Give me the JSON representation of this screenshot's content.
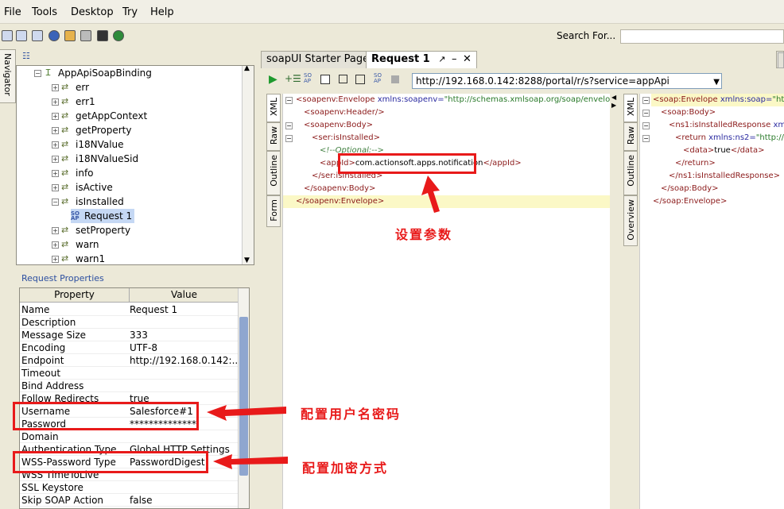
{
  "menu": [
    "File",
    "Tools",
    "Desktop",
    "Try",
    "Help"
  ],
  "search": {
    "label": "Search For..."
  },
  "navigator_label": "Navigator",
  "tree": {
    "binding": "AppApiSoapBinding",
    "operations": [
      "err",
      "err1",
      "getAppContext",
      "getProperty",
      "i18NValue",
      "i18NValueSid",
      "info",
      "isActive",
      "isInstalled"
    ],
    "selected_request": "Request 1",
    "operations_after": [
      "setProperty",
      "warn",
      "warn1"
    ]
  },
  "properties": {
    "title": "Request Properties",
    "col_property": "Property",
    "col_value": "Value",
    "rows": [
      {
        "k": "Name",
        "v": "Request 1"
      },
      {
        "k": "Description",
        "v": ""
      },
      {
        "k": "Message Size",
        "v": "333"
      },
      {
        "k": "Encoding",
        "v": "UTF-8"
      },
      {
        "k": "Endpoint",
        "v": "http://192.168.0.142:..."
      },
      {
        "k": "Timeout",
        "v": ""
      },
      {
        "k": "Bind Address",
        "v": ""
      },
      {
        "k": "Follow Redirects",
        "v": "true"
      },
      {
        "k": "Username",
        "v": "Salesforce#1"
      },
      {
        "k": "Password",
        "v": "**************"
      },
      {
        "k": "Domain",
        "v": ""
      },
      {
        "k": "Authentication Type",
        "v": "Global HTTP Settings"
      },
      {
        "k": "WSS-Password Type",
        "v": "PasswordDigest"
      },
      {
        "k": "WSS TimeToLive",
        "v": ""
      },
      {
        "k": "SSL Keystore",
        "v": ""
      },
      {
        "k": "Skip SOAP Action",
        "v": "false"
      }
    ]
  },
  "tabs": {
    "starter": "soapUI Starter Page",
    "request": "Request 1"
  },
  "endpoint": "http://192.168.0.142:8288/portal/r/s?service=appApi",
  "side_tabs_req": [
    "XML",
    "Raw",
    "Outline",
    "Form"
  ],
  "side_tabs_resp": [
    "XML",
    "Raw",
    "Outline",
    "Overview"
  ],
  "request_xml": {
    "l1_tag": "<soapenv:Envelope ",
    "l1_attr": "xmlns:soapenv=",
    "l1_str": "\"http://schemas.xmlsoap.org/soap/envelop",
    "l2": "<soapenv:Header/>",
    "l3": "<soapenv:Body>",
    "l4": "<ser:isInstalled>",
    "l5": "<!--Optional:-->",
    "l6_open": "<appId>",
    "l6_val": "com.actionsoft.apps.notification",
    "l6_close": "</appId>",
    "l7": "</ser:isInstalled>",
    "l8": "</soapenv:Body>",
    "l9": "</soapenv:Envelope>"
  },
  "response_xml": {
    "l1_tag": "<soap:Envelope ",
    "l1_attr": "xmlns:soap=",
    "l1_str": "\"http:",
    "l2": "<soap:Body>",
    "l3_tag": "<ns1:isInstalledResponse ",
    "l3_attr": "xmlns",
    "l4_tag": "<return ",
    "l4_attr": "xmlns:ns2=",
    "l4_str": "\"http://ser",
    "l5_open": "<data>",
    "l5_val": "true",
    "l5_close": "</data>",
    "l6": "</return>",
    "l7": "</ns1:isInstalledResponse>",
    "l8": "</soap:Body>",
    "l9": "</soap:Envelope>"
  },
  "annotations": {
    "set_params": "设置参数",
    "config_user": "配置用户名密码",
    "config_encrypt": "配置加密方式"
  },
  "colors": {
    "annotation": "#e81a1a",
    "selection": "#c5d8f4",
    "highlight_line": "#fbf8c6"
  }
}
